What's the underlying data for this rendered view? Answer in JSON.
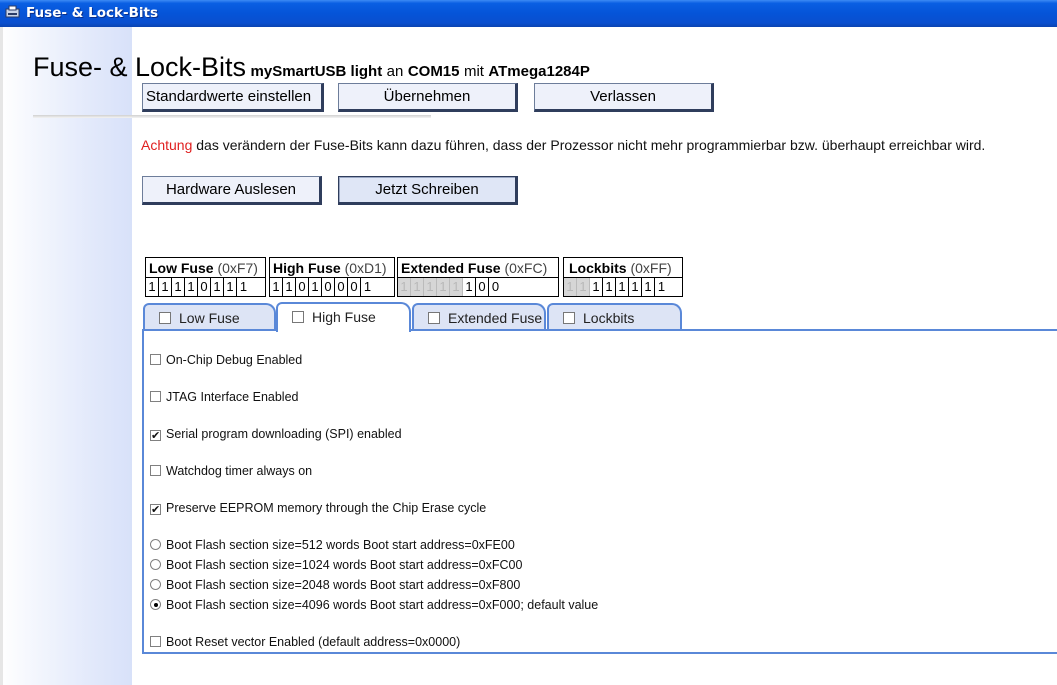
{
  "window": {
    "title": "Fuse- & Lock-Bits"
  },
  "heading": {
    "title": "Fuse- & Lock-Bits",
    "device": "mySmartUSB light",
    "word_an": "an",
    "port": "COM15",
    "word_mit": "mit",
    "chip": "ATmega1284P"
  },
  "buttons": {
    "defaults": "Standardwerte einstellen",
    "apply": "Übernehmen",
    "exit": "Verlassen",
    "read_hw": "Hardware Auslesen",
    "write_now": "Jetzt Schreiben"
  },
  "warning": {
    "prefix": "Achtung",
    "text": " das verändern der Fuse-Bits kann dazu führen, dass der Prozessor nicht mehr programmierbar bzw. überhaupt erreichbar wird."
  },
  "fuses": [
    {
      "name": "Low Fuse",
      "hex": "(0xF7)",
      "bits": [
        "1",
        "1",
        "1",
        "1",
        "0",
        "1",
        "1",
        "1"
      ],
      "disabled": [
        false,
        false,
        false,
        false,
        false,
        false,
        false,
        false
      ]
    },
    {
      "name": "High Fuse",
      "hex": "(0xD1)",
      "bits": [
        "1",
        "1",
        "0",
        "1",
        "0",
        "0",
        "0",
        "1"
      ],
      "disabled": [
        false,
        false,
        false,
        false,
        false,
        false,
        false,
        false
      ]
    },
    {
      "name": "Extended Fuse",
      "hex": "(0xFC)",
      "bits": [
        "1",
        "1",
        "1",
        "1",
        "1",
        "1",
        "0",
        "0"
      ],
      "disabled": [
        true,
        true,
        true,
        true,
        true,
        false,
        false,
        false
      ]
    },
    {
      "name": "Lockbits",
      "hex": "(0xFF)",
      "bits": [
        "1",
        "1",
        "1",
        "1",
        "1",
        "1",
        "1",
        "1"
      ],
      "disabled": [
        true,
        true,
        false,
        false,
        false,
        false,
        false,
        false
      ]
    }
  ],
  "tabs": [
    {
      "label": "Low Fuse",
      "active": false
    },
    {
      "label": "High Fuse",
      "active": true
    },
    {
      "label": "Extended Fuse",
      "active": false
    },
    {
      "label": "Lockbits",
      "active": false
    }
  ],
  "options": {
    "ocd": {
      "label": "On-Chip Debug Enabled",
      "checked": false
    },
    "jtag": {
      "label": "JTAG Interface Enabled",
      "checked": false
    },
    "spi": {
      "label": "Serial program downloading (SPI) enabled",
      "checked": true
    },
    "wdt": {
      "label": "Watchdog timer always on",
      "checked": false
    },
    "eesave": {
      "label": "Preserve EEPROM memory through the Chip Erase cycle",
      "checked": true
    },
    "boot512": {
      "label": "Boot Flash section size=512 words Boot start address=0xFE00",
      "selected": false
    },
    "boot1024": {
      "label": "Boot Flash section size=1024 words Boot start address=0xFC00",
      "selected": false
    },
    "boot2048": {
      "label": "Boot Flash section size=2048 words Boot start address=0xF800",
      "selected": false
    },
    "boot4096": {
      "label": "Boot Flash section size=4096 words Boot start address=0xF000; default value",
      "selected": true
    },
    "bootrst": {
      "label": "Boot Reset vector Enabled (default address=0x0000)",
      "checked": false
    }
  }
}
